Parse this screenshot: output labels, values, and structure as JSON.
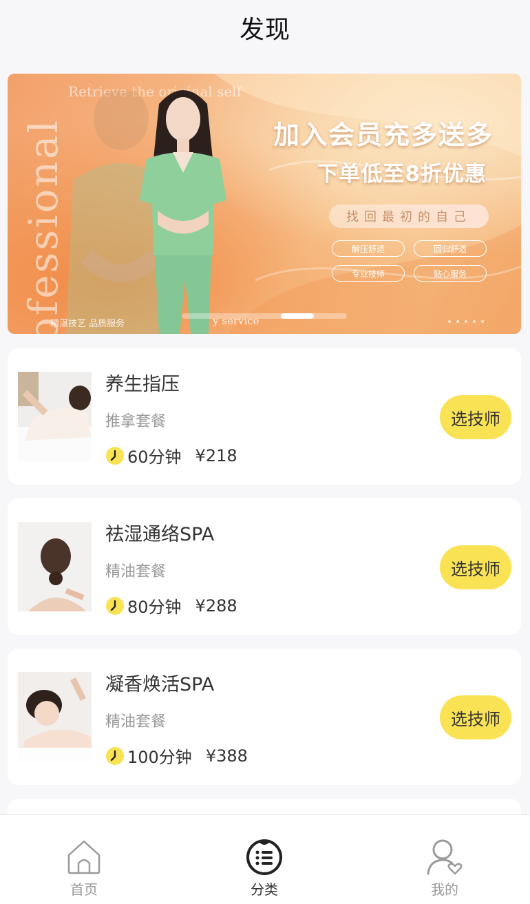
{
  "header": {
    "title": "发现"
  },
  "banner": {
    "vertical_word": "professional",
    "top_text": "Retrieve the original self",
    "headline": "加入会员充多送多",
    "subhead": "下单低至8折优惠",
    "pill": "找回最初的自己",
    "tags": [
      "解压舒适",
      "回归舒适",
      "专业技师",
      "贴心服务"
    ],
    "bottom_left": "精湛技艺 品质服务",
    "bottom_mid": "y service"
  },
  "services": [
    {
      "name": "养生指压",
      "package": "推拿套餐",
      "duration": "60分钟",
      "price": "¥218",
      "button": "选技师"
    },
    {
      "name": "祛湿通络SPA",
      "package": "精油套餐",
      "duration": "80分钟",
      "price": "¥288",
      "button": "选技师"
    },
    {
      "name": "凝香焕活SPA",
      "package": "精油套餐",
      "duration": "100分钟",
      "price": "¥388",
      "button": "选技师"
    }
  ],
  "tabbar": {
    "items": [
      {
        "label": "首页",
        "icon": "home-icon",
        "active": false
      },
      {
        "label": "分类",
        "icon": "category-icon",
        "active": true
      },
      {
        "label": "我的",
        "icon": "profile-icon",
        "active": false
      }
    ]
  },
  "colors": {
    "accent": "#f9e253",
    "background": "#f7f7f9",
    "banner": "#f6b986"
  }
}
